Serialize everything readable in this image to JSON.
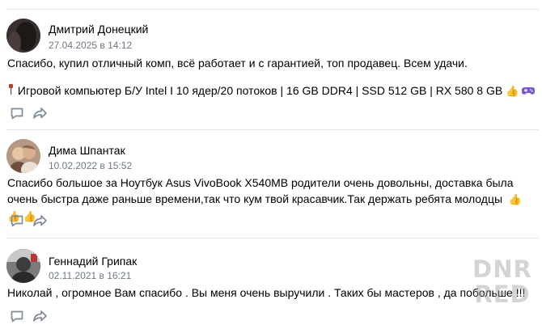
{
  "reviews": [
    {
      "author": "Дмитрий Донецкий",
      "date": "27.04.2025 в 14:12",
      "text": "Спасибо, купил отличный комп, всё работает и с гарантией, топ продавец. Всем удачи.",
      "text2": "Игровой компьютер Б/У Intel I 10 ядер/20 потоков | 16 GB DDR4 | SSD 512 GB | RX 580 8 GB"
    },
    {
      "author": "Дима Шпантак",
      "date": "10.02.2022 в 15:52",
      "text": "Спасибо большое за Ноутбук Asus VivoBook X540MB родители очень довольны, доставка была очень быстра даже раньше времени,так что кум твой красавчик.Так держать ребята молодцы"
    },
    {
      "author": "Геннадий Грипак",
      "date": "02.11.2021 в 16:21",
      "text": "Николай , огромное Вам спасибо . Вы меня очень выручили . Таких бы мастеров , да побольше !!!"
    }
  ],
  "icons": {
    "comment": "comment-icon",
    "share": "share-icon",
    "pin": "pin-icon",
    "joystick": "gamepad-icon",
    "thumbs": "thumbs-up-emoji"
  },
  "watermark": {
    "line1": "DNR",
    "line2": "RED"
  },
  "colors": {
    "date": "#6f7985",
    "divider": "#e3e4e8",
    "icon": "#818c99"
  }
}
